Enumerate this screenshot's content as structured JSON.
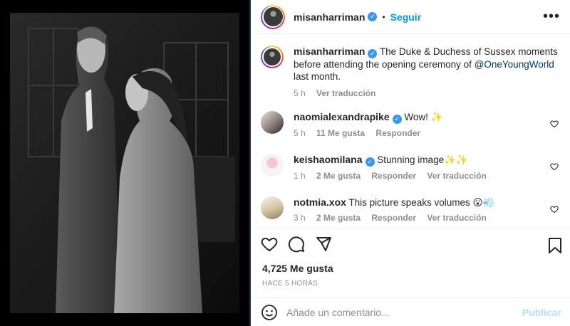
{
  "header": {
    "username": "misanharriman",
    "dot": "•",
    "follow_label": "Seguir",
    "more_label": "•••"
  },
  "caption": {
    "username": "misanharriman",
    "text_before": "The Duke & Duchess of Sussex moments before attending the opening ceremony of ",
    "mention": "@OneYoungWorld",
    "text_after": " last month.",
    "time": "5 h",
    "translate_label": "Ver traducción"
  },
  "comments": [
    {
      "username": "naomialexandrapike",
      "verified": true,
      "text": "Wow! ✨",
      "time": "5 h",
      "likes": "11 Me gusta",
      "reply": "Responder",
      "translate": ""
    },
    {
      "username": "keishaomilana",
      "verified": true,
      "text": "Stunning image✨✨",
      "time": "1 h",
      "likes": "2 Me gusta",
      "reply": "Responder",
      "translate": "Ver traducción"
    },
    {
      "username": "notmia.xox",
      "verified": false,
      "text": "This picture speaks volumes 😮💨",
      "time": "3 h",
      "likes": "2 Me gusta",
      "reply": "Responder",
      "translate": "Ver traducción"
    }
  ],
  "actions": {
    "likes": "4,725 Me gusta",
    "time_ago": "HACE 5 HORAS"
  },
  "comment_box": {
    "placeholder": "Añade un comentario...",
    "publish_label": "Publicar"
  },
  "colors": {
    "accent": "#0095f6",
    "verified": "#3897f0",
    "mention": "#00376b",
    "muted": "#8e8e8e"
  },
  "icons": [
    "verified-icon",
    "more-icon",
    "heart-icon",
    "comment-icon",
    "share-icon",
    "bookmark-icon",
    "emoji-icon"
  ]
}
